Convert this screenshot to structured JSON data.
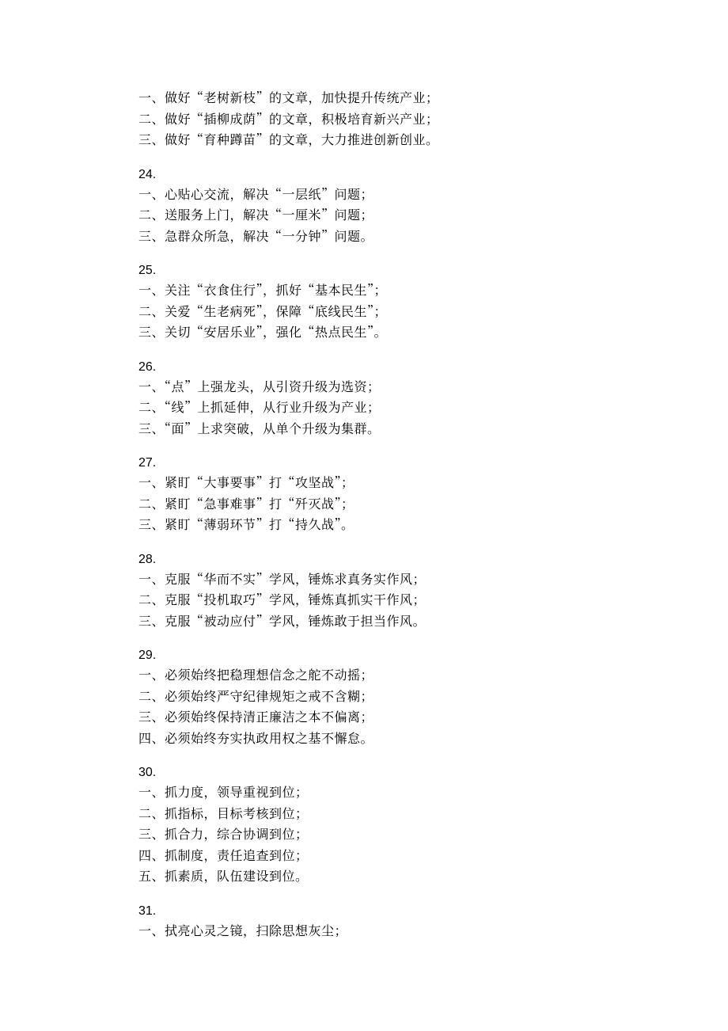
{
  "blocks": [
    {
      "num": null,
      "lines": [
        "一、做好\"老树新枝\"的文章，加快提升传统产业；",
        "二、做好\"插柳成荫\"的文章，积极培育新兴产业；",
        "三、做好\"育种蹲苗\"的文章，大力推进创新创业。"
      ]
    },
    {
      "num": "24.",
      "lines": [
        "一、心贴心交流，解决\"一层纸\"问题；",
        "二、送服务上门，解决\"一厘米\"问题；",
        "三、急群众所急，解决\"一分钟\"问题。"
      ]
    },
    {
      "num": "25.",
      "lines": [
        "一、关注\"衣食住行\"，抓好\"基本民生\"；",
        "二、关爱\"生老病死\"，保障\"底线民生\"；",
        "三、关切\"安居乐业\"，强化\"热点民生\"。"
      ]
    },
    {
      "num": "26.",
      "lines": [
        "一、\"点\"上强龙头，从引资升级为选资；",
        "二、\"线\"上抓延伸，从行业升级为产业；",
        "三、\"面\"上求突破，从单个升级为集群。"
      ]
    },
    {
      "num": "27.",
      "lines": [
        "一、紧盯\"大事要事\"打\"攻坚战\"；",
        "二、紧盯\"急事难事\"打\"歼灭战\"；",
        "三、紧盯\"薄弱环节\"打\"持久战\"。"
      ]
    },
    {
      "num": "28.",
      "lines": [
        "一、克服\"华而不实\"学风，锤炼求真务实作风；",
        "二、克服\"投机取巧\"学风，锤炼真抓实干作风；",
        "三、克服\"被动应付\"学风，锤炼敢于担当作风。"
      ]
    },
    {
      "num": "29.",
      "lines": [
        "一、必须始终把稳理想信念之舵不动摇；",
        "二、必须始终严守纪律规矩之戒不含糊；",
        "三、必须始终保持清正廉洁之本不偏离；",
        "四、必须始终夯实执政用权之基不懈怠。"
      ]
    },
    {
      "num": "30.",
      "lines": [
        "一、抓力度，领导重视到位；",
        "二、抓指标，目标考核到位；",
        "三、抓合力，综合协调到位；",
        "四、抓制度，责任追查到位；",
        "五、抓素质，队伍建设到位。"
      ]
    },
    {
      "num": "31.",
      "lines": [
        "一、拭亮心灵之镜，扫除思想灰尘；"
      ]
    }
  ]
}
